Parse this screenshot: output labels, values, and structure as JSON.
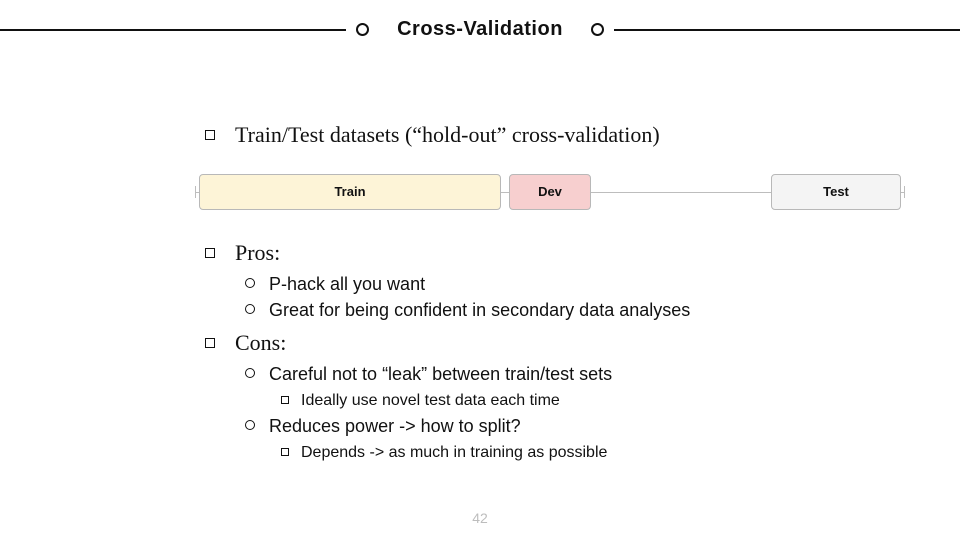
{
  "title": "Cross-Validation",
  "page_number": "42",
  "bullets": {
    "b1": "Train/Test datasets (“hold-out” cross-validation)",
    "b2": "Pros:",
    "b2_1": "P-hack all you want",
    "b2_2": "Great for being confident in secondary data analyses",
    "b3": "Cons:",
    "b3_1": "Careful not to “leak” between train/test sets",
    "b3_1_1": "Ideally use novel test data each time",
    "b3_2": "Reduces power -> how to split?",
    "b3_2_1": "Depends -> as much in training as possible"
  },
  "diagram": {
    "train": "Train",
    "dev": "Dev",
    "test": "Test"
  }
}
